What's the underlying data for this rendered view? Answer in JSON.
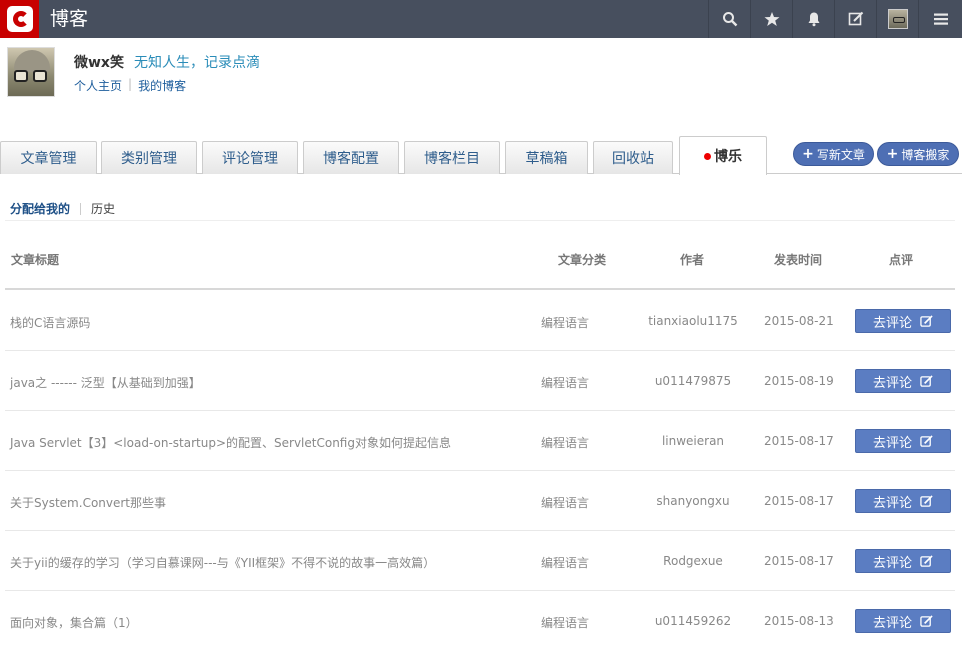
{
  "topbar": {
    "title": "博客",
    "icons": [
      "search-icon",
      "star-icon",
      "bell-icon",
      "edit-icon",
      "avatar",
      "menu-icon"
    ]
  },
  "profile": {
    "name": "微wx笑",
    "motto": "无知人生，记录点滴",
    "links": [
      "个人主页",
      "我的博客"
    ]
  },
  "tabs": [
    "文章管理",
    "类别管理",
    "评论管理",
    "博客配置",
    "博客栏目",
    "草稿箱",
    "回收站",
    "博乐"
  ],
  "actions": {
    "write": "写新文章",
    "move": "博客搬家"
  },
  "subnav": {
    "assigned": "分配给我的",
    "history": "历史"
  },
  "table": {
    "headers": [
      "文章标题",
      "文章分类",
      "作者",
      "发表时间",
      "点评"
    ],
    "button_label": "去评论",
    "rows": [
      {
        "title": "栈的C语言源码",
        "category": "编程语言",
        "author": "tianxiaolu1175",
        "date": "2015-08-21"
      },
      {
        "title": "java之 ------ 泛型【从基础到加强】",
        "category": "编程语言",
        "author": "u011479875",
        "date": "2015-08-19"
      },
      {
        "title": "Java Servlet【3】<load-on-startup>的配置、ServletConfig对象如何提起信息",
        "category": "编程语言",
        "author": "linweieran",
        "date": "2015-08-17"
      },
      {
        "title": "关于System.Convert那些事",
        "category": "编程语言",
        "author": "shanyongxu",
        "date": "2015-08-17"
      },
      {
        "title": "关于yii的缓存的学习（学习自慕课网---与《YII框架》不得不说的故事一高效篇）",
        "category": "编程语言",
        "author": "Rodgexue",
        "date": "2015-08-17"
      },
      {
        "title": "面向对象，集合篇（1）",
        "category": "编程语言",
        "author": "u011459262",
        "date": "2015-08-13"
      }
    ]
  },
  "colors": {
    "topbar": "#474f5e",
    "brand": "#c80000",
    "accent": "#5b7dc2",
    "link": "#2a8cb8"
  }
}
